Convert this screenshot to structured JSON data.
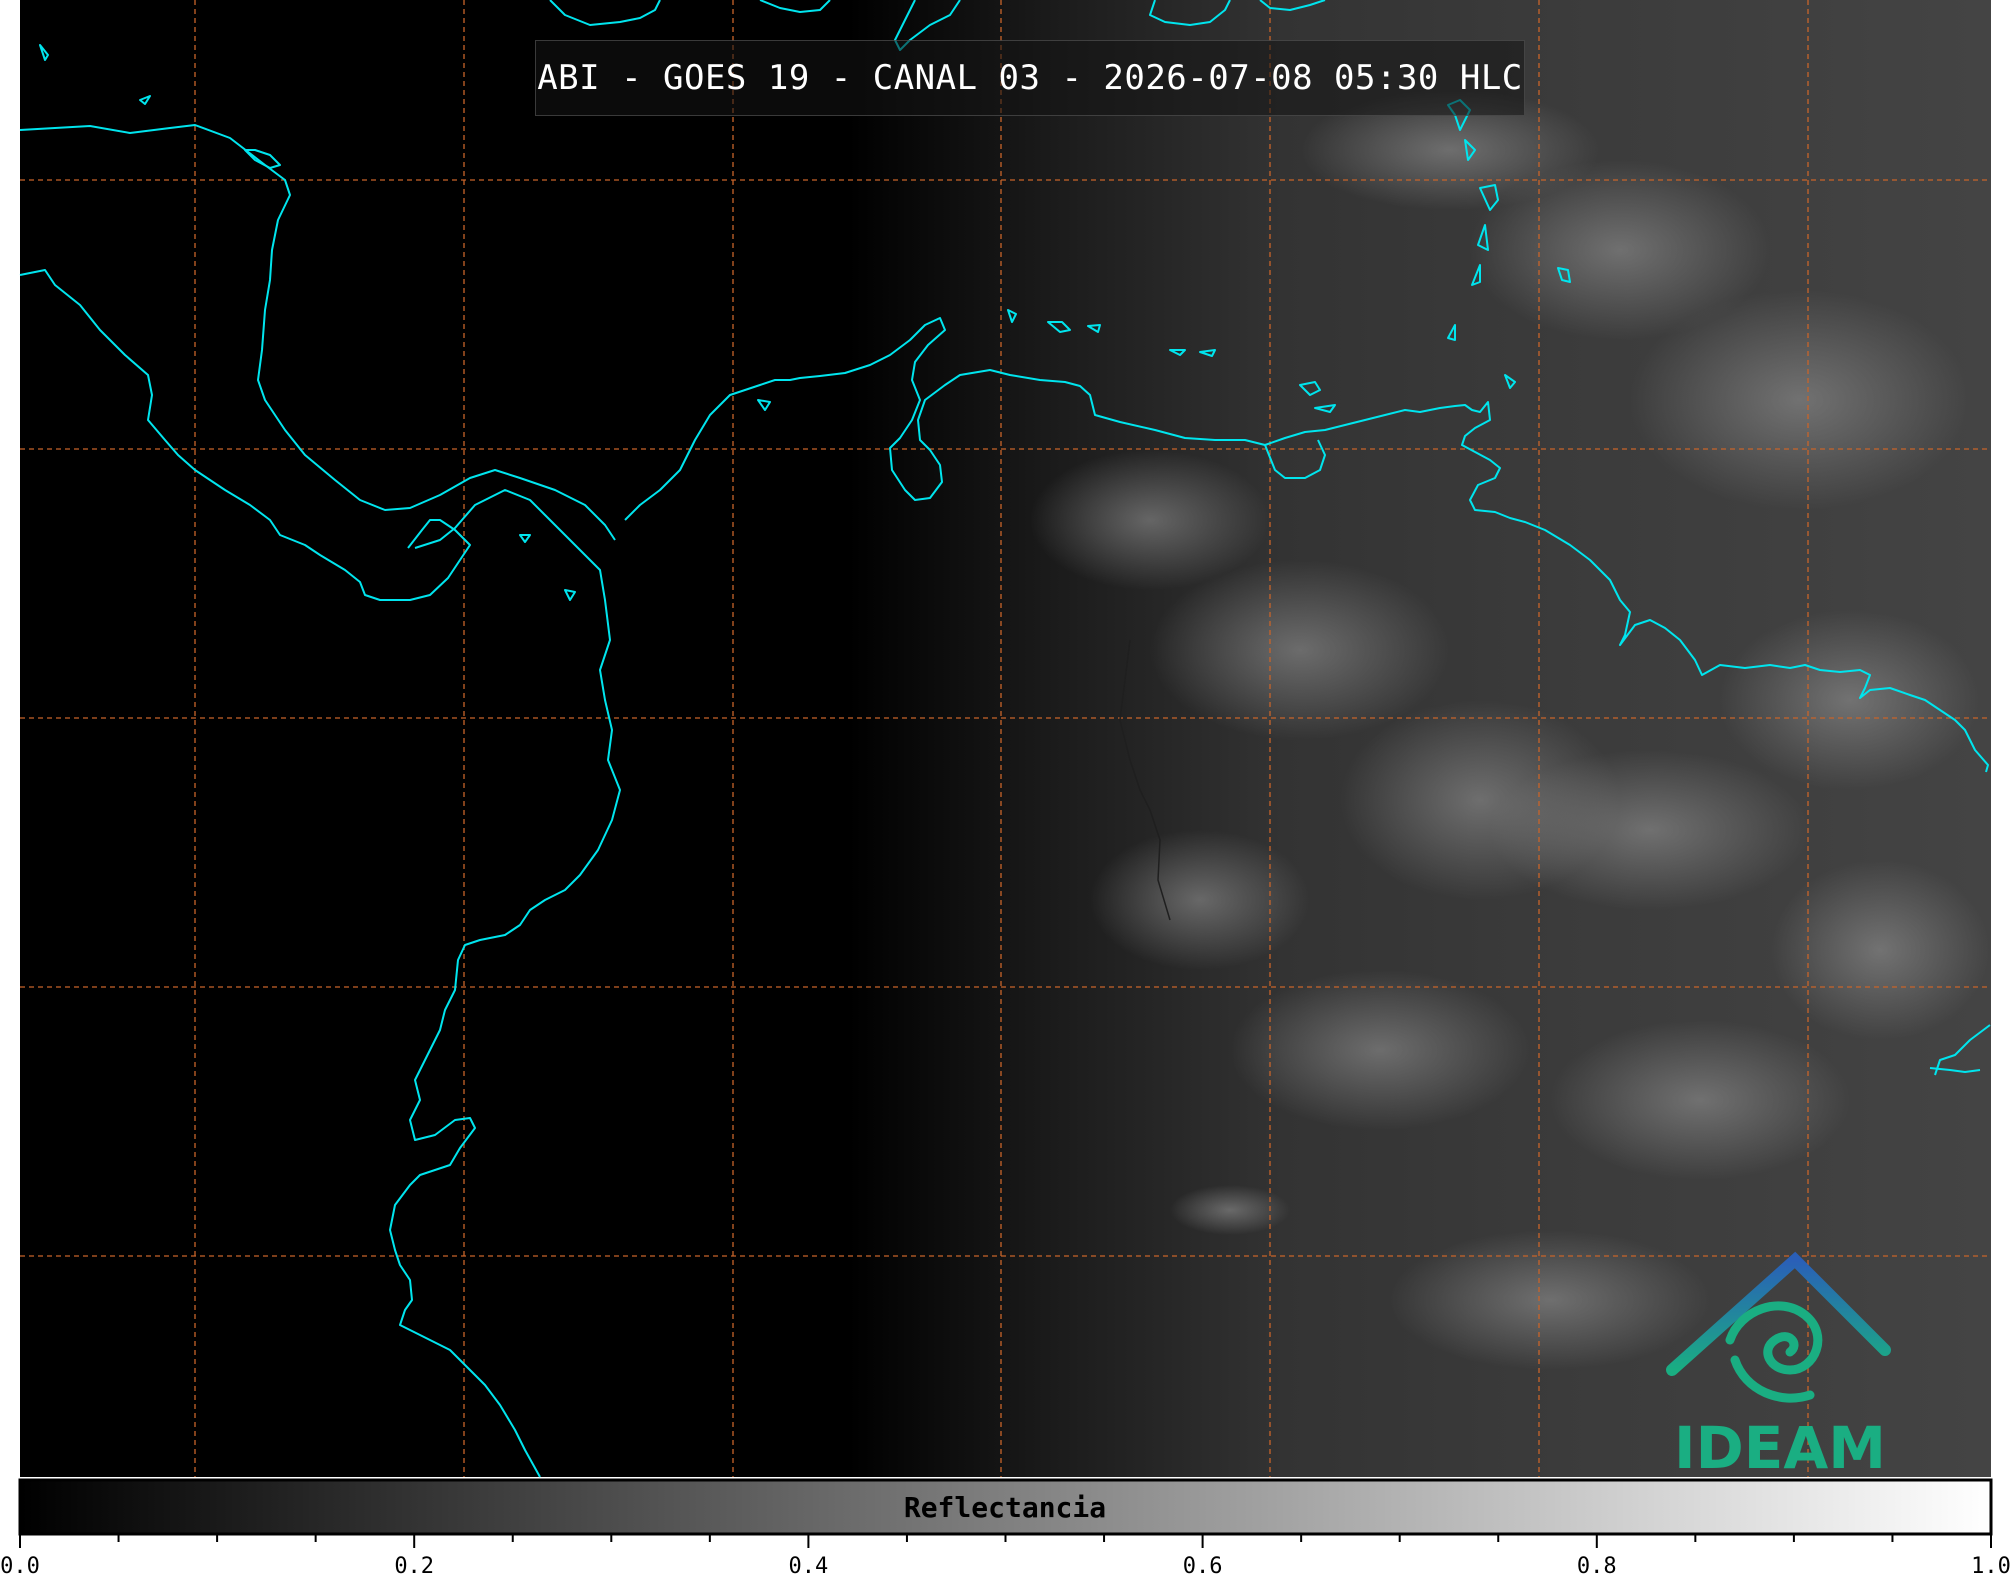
{
  "title": "ABI - GOES 19 - CANAL 03 - 2026-07-08 05:30 HLC",
  "colorbar": {
    "label": "Reflectancia",
    "ticks": [
      "0.0",
      "0.2",
      "0.4",
      "0.6",
      "0.8",
      "1.0"
    ],
    "range": [
      0.0,
      1.0
    ],
    "colormap": "grayscale black-to-white"
  },
  "logo": {
    "text": "IDEAM"
  },
  "colors": {
    "coastline": "#00e5ee",
    "graticule": "#c8642a",
    "background": "#000000",
    "logo_blue": "#2a6fb8",
    "logo_green": "#1aae82"
  }
}
